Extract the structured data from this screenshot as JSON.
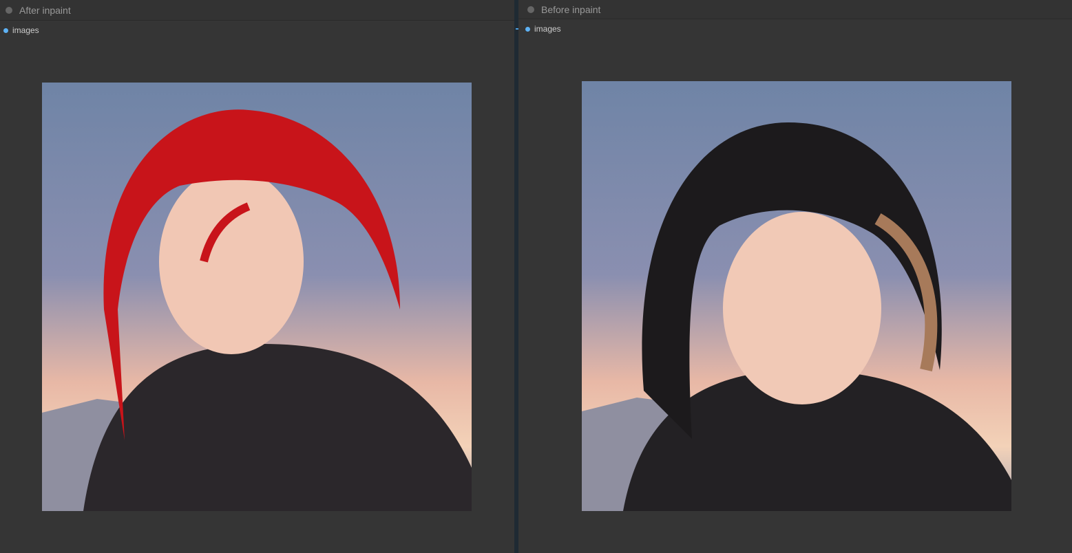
{
  "nodes": [
    {
      "title": "After inpaint",
      "output_label": "images",
      "hair_color": "#c8141a"
    },
    {
      "title": "Before inpaint",
      "output_label": "images",
      "hair_color": "#1c1a1c"
    }
  ],
  "colors": {
    "slot_dot": "#5eb2f5",
    "node_bg": "#353535"
  }
}
